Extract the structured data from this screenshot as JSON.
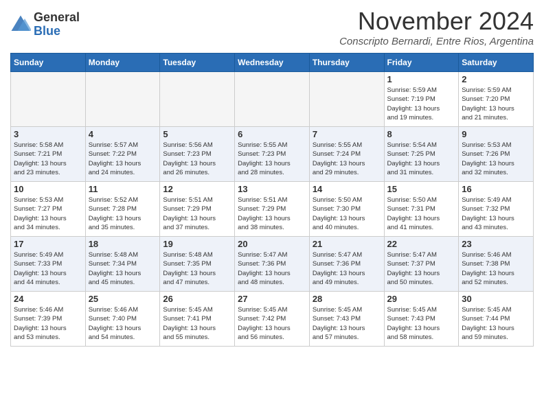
{
  "logo": {
    "general": "General",
    "blue": "Blue"
  },
  "title": "November 2024",
  "location": "Conscripto Bernardi, Entre Rios, Argentina",
  "weekdays": [
    "Sunday",
    "Monday",
    "Tuesday",
    "Wednesday",
    "Thursday",
    "Friday",
    "Saturday"
  ],
  "weeks": [
    [
      {
        "day": "",
        "info": ""
      },
      {
        "day": "",
        "info": ""
      },
      {
        "day": "",
        "info": ""
      },
      {
        "day": "",
        "info": ""
      },
      {
        "day": "",
        "info": ""
      },
      {
        "day": "1",
        "info": "Sunrise: 5:59 AM\nSunset: 7:19 PM\nDaylight: 13 hours\nand 19 minutes."
      },
      {
        "day": "2",
        "info": "Sunrise: 5:59 AM\nSunset: 7:20 PM\nDaylight: 13 hours\nand 21 minutes."
      }
    ],
    [
      {
        "day": "3",
        "info": "Sunrise: 5:58 AM\nSunset: 7:21 PM\nDaylight: 13 hours\nand 23 minutes."
      },
      {
        "day": "4",
        "info": "Sunrise: 5:57 AM\nSunset: 7:22 PM\nDaylight: 13 hours\nand 24 minutes."
      },
      {
        "day": "5",
        "info": "Sunrise: 5:56 AM\nSunset: 7:23 PM\nDaylight: 13 hours\nand 26 minutes."
      },
      {
        "day": "6",
        "info": "Sunrise: 5:55 AM\nSunset: 7:23 PM\nDaylight: 13 hours\nand 28 minutes."
      },
      {
        "day": "7",
        "info": "Sunrise: 5:55 AM\nSunset: 7:24 PM\nDaylight: 13 hours\nand 29 minutes."
      },
      {
        "day": "8",
        "info": "Sunrise: 5:54 AM\nSunset: 7:25 PM\nDaylight: 13 hours\nand 31 minutes."
      },
      {
        "day": "9",
        "info": "Sunrise: 5:53 AM\nSunset: 7:26 PM\nDaylight: 13 hours\nand 32 minutes."
      }
    ],
    [
      {
        "day": "10",
        "info": "Sunrise: 5:53 AM\nSunset: 7:27 PM\nDaylight: 13 hours\nand 34 minutes."
      },
      {
        "day": "11",
        "info": "Sunrise: 5:52 AM\nSunset: 7:28 PM\nDaylight: 13 hours\nand 35 minutes."
      },
      {
        "day": "12",
        "info": "Sunrise: 5:51 AM\nSunset: 7:29 PM\nDaylight: 13 hours\nand 37 minutes."
      },
      {
        "day": "13",
        "info": "Sunrise: 5:51 AM\nSunset: 7:29 PM\nDaylight: 13 hours\nand 38 minutes."
      },
      {
        "day": "14",
        "info": "Sunrise: 5:50 AM\nSunset: 7:30 PM\nDaylight: 13 hours\nand 40 minutes."
      },
      {
        "day": "15",
        "info": "Sunrise: 5:50 AM\nSunset: 7:31 PM\nDaylight: 13 hours\nand 41 minutes."
      },
      {
        "day": "16",
        "info": "Sunrise: 5:49 AM\nSunset: 7:32 PM\nDaylight: 13 hours\nand 43 minutes."
      }
    ],
    [
      {
        "day": "17",
        "info": "Sunrise: 5:49 AM\nSunset: 7:33 PM\nDaylight: 13 hours\nand 44 minutes."
      },
      {
        "day": "18",
        "info": "Sunrise: 5:48 AM\nSunset: 7:34 PM\nDaylight: 13 hours\nand 45 minutes."
      },
      {
        "day": "19",
        "info": "Sunrise: 5:48 AM\nSunset: 7:35 PM\nDaylight: 13 hours\nand 47 minutes."
      },
      {
        "day": "20",
        "info": "Sunrise: 5:47 AM\nSunset: 7:36 PM\nDaylight: 13 hours\nand 48 minutes."
      },
      {
        "day": "21",
        "info": "Sunrise: 5:47 AM\nSunset: 7:36 PM\nDaylight: 13 hours\nand 49 minutes."
      },
      {
        "day": "22",
        "info": "Sunrise: 5:47 AM\nSunset: 7:37 PM\nDaylight: 13 hours\nand 50 minutes."
      },
      {
        "day": "23",
        "info": "Sunrise: 5:46 AM\nSunset: 7:38 PM\nDaylight: 13 hours\nand 52 minutes."
      }
    ],
    [
      {
        "day": "24",
        "info": "Sunrise: 5:46 AM\nSunset: 7:39 PM\nDaylight: 13 hours\nand 53 minutes."
      },
      {
        "day": "25",
        "info": "Sunrise: 5:46 AM\nSunset: 7:40 PM\nDaylight: 13 hours\nand 54 minutes."
      },
      {
        "day": "26",
        "info": "Sunrise: 5:45 AM\nSunset: 7:41 PM\nDaylight: 13 hours\nand 55 minutes."
      },
      {
        "day": "27",
        "info": "Sunrise: 5:45 AM\nSunset: 7:42 PM\nDaylight: 13 hours\nand 56 minutes."
      },
      {
        "day": "28",
        "info": "Sunrise: 5:45 AM\nSunset: 7:43 PM\nDaylight: 13 hours\nand 57 minutes."
      },
      {
        "day": "29",
        "info": "Sunrise: 5:45 AM\nSunset: 7:43 PM\nDaylight: 13 hours\nand 58 minutes."
      },
      {
        "day": "30",
        "info": "Sunrise: 5:45 AM\nSunset: 7:44 PM\nDaylight: 13 hours\nand 59 minutes."
      }
    ]
  ]
}
